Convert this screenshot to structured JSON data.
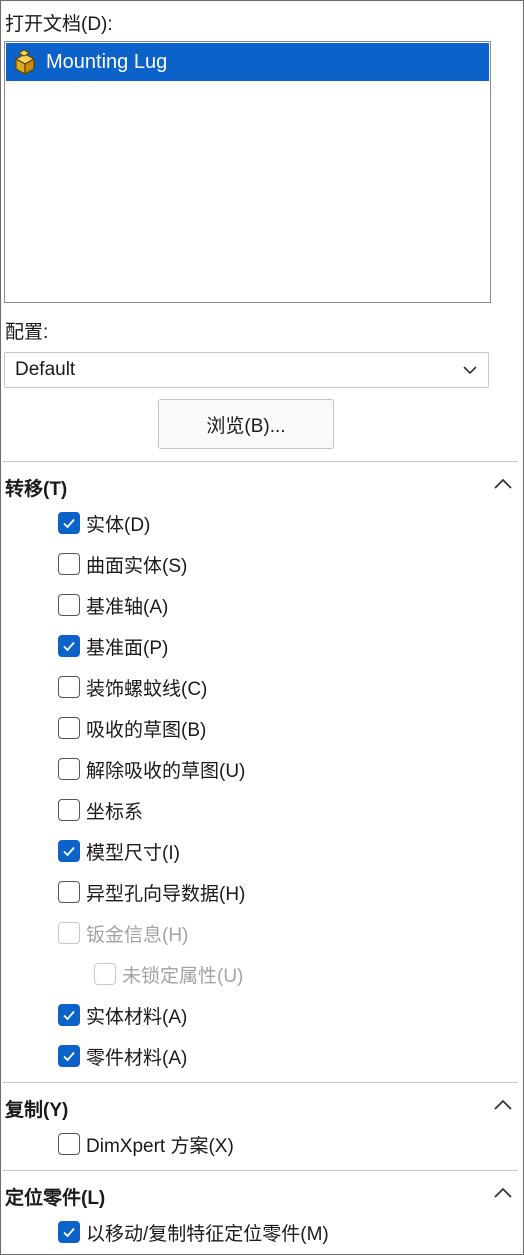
{
  "open_documents": {
    "label": "打开文档(D):",
    "items": [
      {
        "label": "Mounting Lug",
        "icon": "part-icon",
        "selected": true
      }
    ]
  },
  "configuration": {
    "label": "配置:",
    "selected": "Default"
  },
  "browse_button": {
    "label": "浏览(B)..."
  },
  "transfer": {
    "title": "转移(T)",
    "items": [
      {
        "label": "实体(D)",
        "checked": true,
        "enabled": true
      },
      {
        "label": "曲面实体(S)",
        "checked": false,
        "enabled": true
      },
      {
        "label": "基准轴(A)",
        "checked": false,
        "enabled": true
      },
      {
        "label": "基准面(P)",
        "checked": true,
        "enabled": true
      },
      {
        "label": "装饰螺蚊线(C)",
        "checked": false,
        "enabled": true
      },
      {
        "label": "吸收的草图(B)",
        "checked": false,
        "enabled": true
      },
      {
        "label": "解除吸收的草图(U)",
        "checked": false,
        "enabled": true
      },
      {
        "label": "坐标系",
        "checked": false,
        "enabled": true
      },
      {
        "label": "模型尺寸(I)",
        "checked": true,
        "enabled": true
      },
      {
        "label": "异型孔向导数据(H)",
        "checked": false,
        "enabled": true
      },
      {
        "label": "钣金信息(H)",
        "checked": false,
        "enabled": false
      },
      {
        "label": "未锁定属性(U)",
        "checked": false,
        "enabled": false
      },
      {
        "label": "实体材料(A)",
        "checked": true,
        "enabled": true
      },
      {
        "label": "零件材料(A)",
        "checked": true,
        "enabled": true
      }
    ]
  },
  "copy": {
    "title": "复制(Y)",
    "items": [
      {
        "label": "DimXpert 方案(X)",
        "checked": false,
        "enabled": true
      }
    ]
  },
  "locate_part": {
    "title": "定位零件(L)",
    "items": [
      {
        "label": "以移动/复制特征定位零件(M)",
        "checked": true,
        "enabled": true
      }
    ]
  },
  "colors": {
    "accent": "#0b63c9",
    "disabled_text": "#a3a3a3"
  }
}
